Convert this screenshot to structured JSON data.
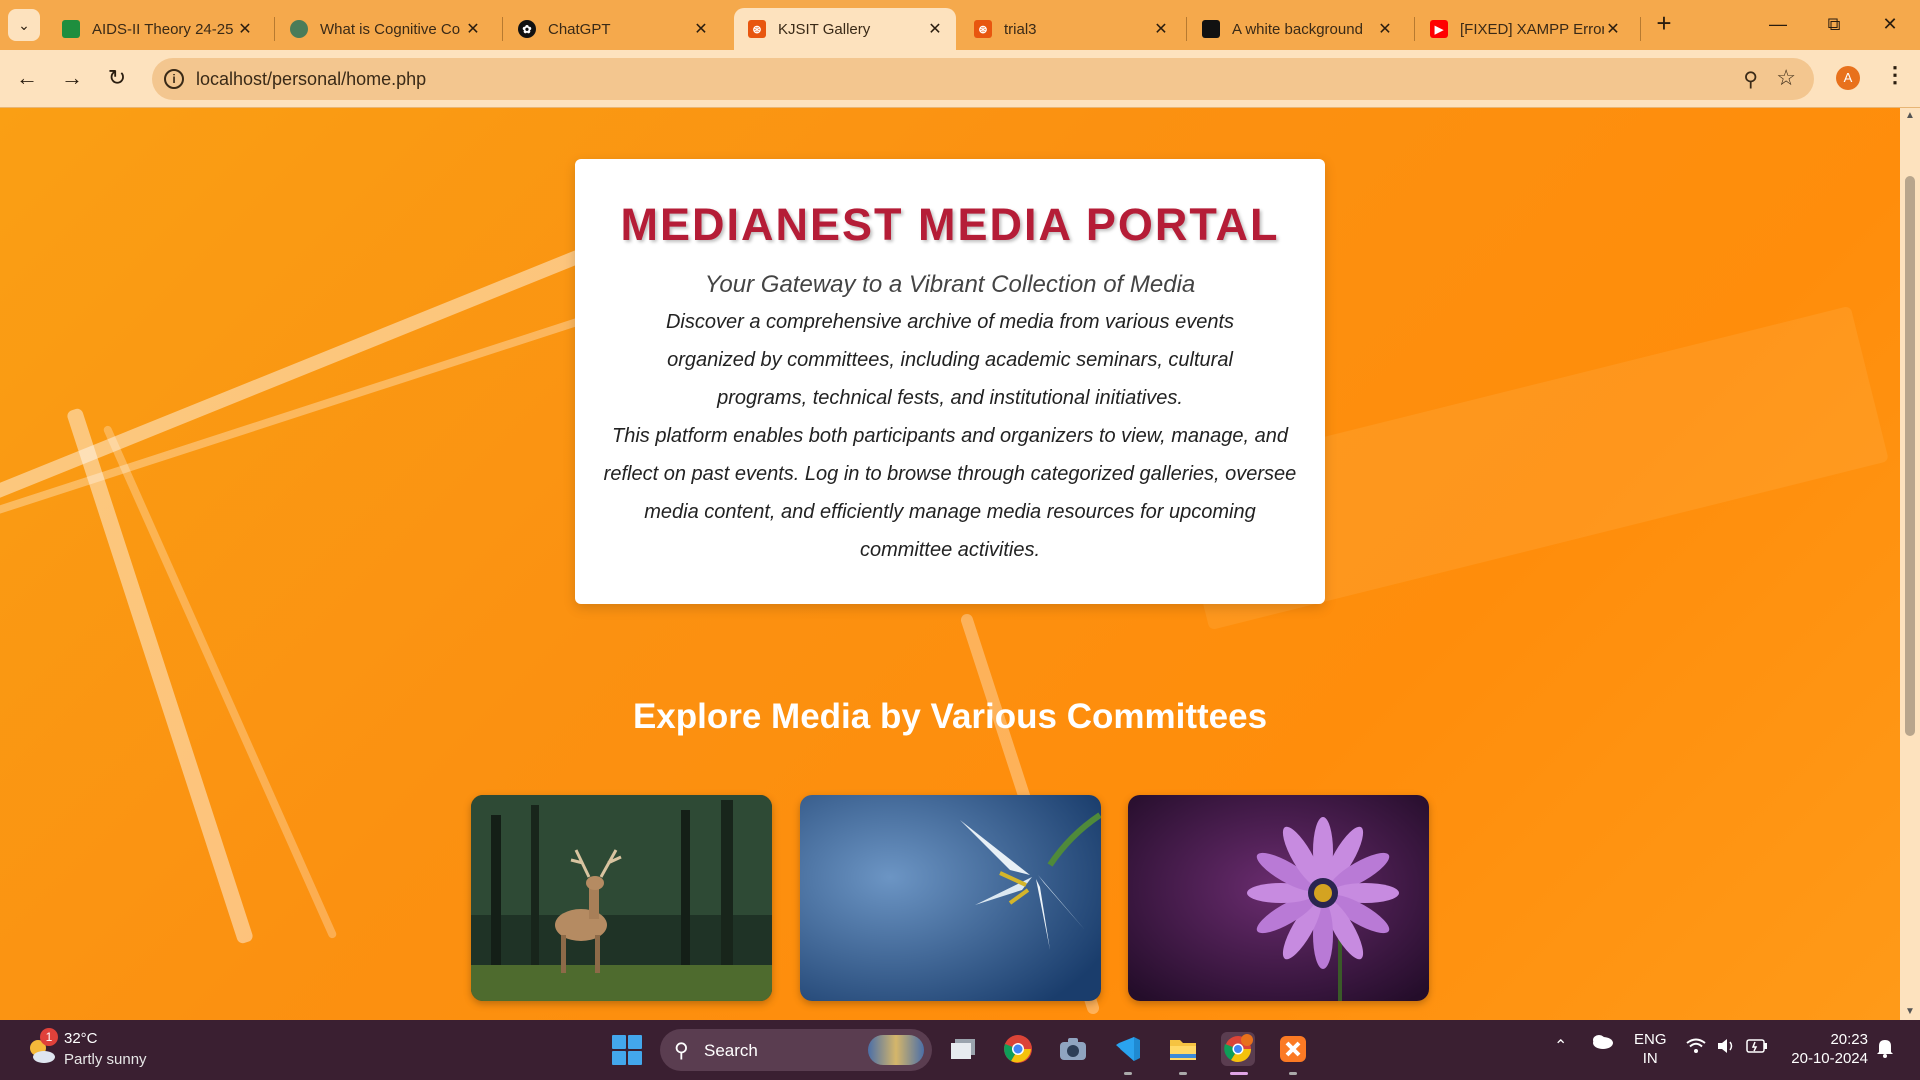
{
  "browser": {
    "tabs": [
      {
        "title": "AIDS-II Theory 24-25",
        "favicon_color": "#1e8e3e",
        "active": false
      },
      {
        "title": "What is Cognitive Co",
        "favicon_color": "#4a7c59",
        "active": false
      },
      {
        "title": "ChatGPT",
        "favicon_color": "#111111",
        "active": false
      },
      {
        "title": "KJSIT Gallery",
        "favicon_color": "#e8560f",
        "active": true
      },
      {
        "title": "trial3",
        "favicon_color": "#e8560f",
        "active": false
      },
      {
        "title": "A white background",
        "favicon_color": "#111111",
        "active": false
      },
      {
        "title": "[FIXED] XAMPP Error",
        "favicon_color": "#ff0000",
        "active": false
      }
    ],
    "url": "localhost/personal/home.php",
    "profile_initial": "A"
  },
  "page": {
    "heading": "MEDIANEST MEDIA PORTAL",
    "subheading": "Your Gateway to a Vibrant Collection of Media",
    "paragraph_1": "Discover a comprehensive archive of media from various events organized by committees, including academic seminars, cultural programs, technical fests, and institutional initiatives.",
    "paragraph_2": "This platform enables both participants and organizers to view, manage, and reflect on past events. Log in to browse through categorized galleries, oversee media content, and efficiently manage media resources for upcoming committee activities.",
    "section_title": "Explore Media by Various Committees",
    "cards": [
      {
        "subject": "deer-in-forest"
      },
      {
        "subject": "white-lily-on-blue"
      },
      {
        "subject": "purple-daisy"
      }
    ],
    "colors": {
      "background": "#fb9111",
      "heading": "#b51d37"
    }
  },
  "taskbar": {
    "weather_badge": "1",
    "temperature": "32°C",
    "weather": "Partly sunny",
    "search_label": "Search",
    "lang_primary": "ENG",
    "lang_secondary": "IN",
    "time": "20:23",
    "date": "20-10-2024"
  }
}
